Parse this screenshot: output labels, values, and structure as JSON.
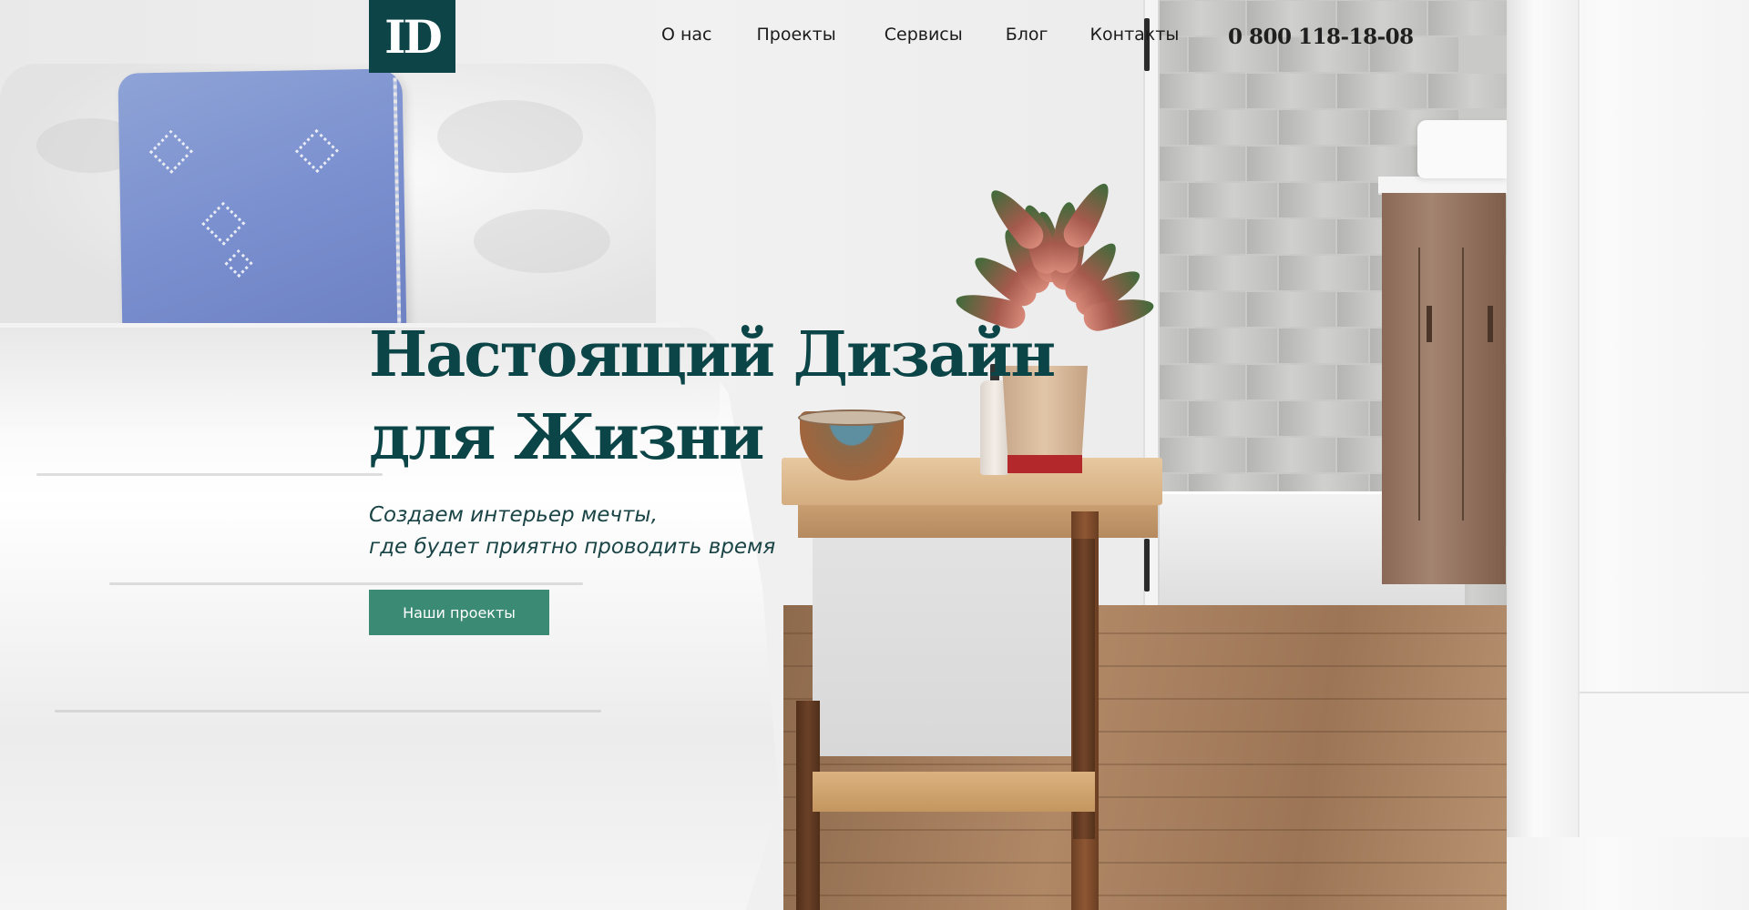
{
  "brand": {
    "logo_text": "ID",
    "primary_color": "#0d4447",
    "accent_color": "#3b8a74"
  },
  "nav": {
    "items": [
      {
        "label": "О нас"
      },
      {
        "label": "Проекты"
      },
      {
        "label": "Сервисы"
      },
      {
        "label": "Блог"
      },
      {
        "label": "Контакты"
      }
    ]
  },
  "contact": {
    "phone": "0 800 118-18-08"
  },
  "hero": {
    "title_line1": "Настоящий Дизайн",
    "title_line2": "для Жизни",
    "subtitle_line1": "Создаем интерьер мечты,",
    "subtitle_line2": "где будет приятно проводить время",
    "cta_label": "Наши проекты"
  },
  "background": {
    "icon": "bedroom-interior-photo"
  }
}
